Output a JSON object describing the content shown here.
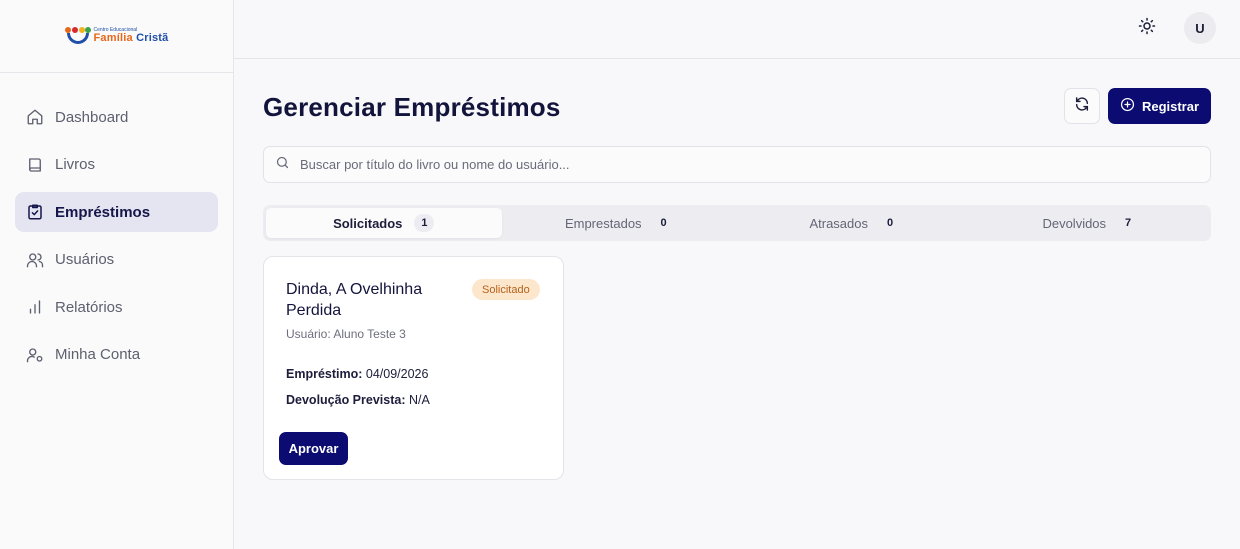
{
  "brand": {
    "small": "Centro Educacional",
    "name_part1": "Família",
    "name_part2": "Cristã"
  },
  "sidebar": {
    "items": [
      {
        "label": "Dashboard",
        "icon": "home-icon"
      },
      {
        "label": "Livros",
        "icon": "book-icon"
      },
      {
        "label": "Empréstimos",
        "icon": "clipboard-check-icon",
        "active": true
      },
      {
        "label": "Usuários",
        "icon": "users-icon"
      },
      {
        "label": "Relatórios",
        "icon": "bar-chart-icon"
      },
      {
        "label": "Minha Conta",
        "icon": "user-cog-icon"
      }
    ]
  },
  "topbar": {
    "theme_icon": "sun-icon",
    "avatar_initial": "U"
  },
  "page": {
    "title": "Gerenciar Empréstimos",
    "register_label": "Registrar"
  },
  "search": {
    "placeholder": "Buscar por título do livro ou nome do usuário...",
    "value": ""
  },
  "tabs": [
    {
      "label": "Solicitados",
      "count": "1",
      "active": true
    },
    {
      "label": "Emprestados",
      "count": "0"
    },
    {
      "label": "Atrasados",
      "count": "0"
    },
    {
      "label": "Devolvidos",
      "count": "7"
    }
  ],
  "loans": [
    {
      "title": "Dinda, A Ovelhinha Perdida",
      "status": "Solicitado",
      "user_label": "Usuário: Aluno Teste 3",
      "loan_label": "Empréstimo:",
      "loan_date": "04/09/2026",
      "due_label": "Devolução Prevista:",
      "due_date": "N/A",
      "action_label": "Aprovar"
    }
  ],
  "colors": {
    "primary": "#0b0b72",
    "active_nav_bg": "#e5e5f1",
    "badge_bg": "#fde7cc",
    "badge_text": "#b4621a",
    "brand_orange": "#e8671b",
    "brand_blue": "#1f4fa8"
  }
}
